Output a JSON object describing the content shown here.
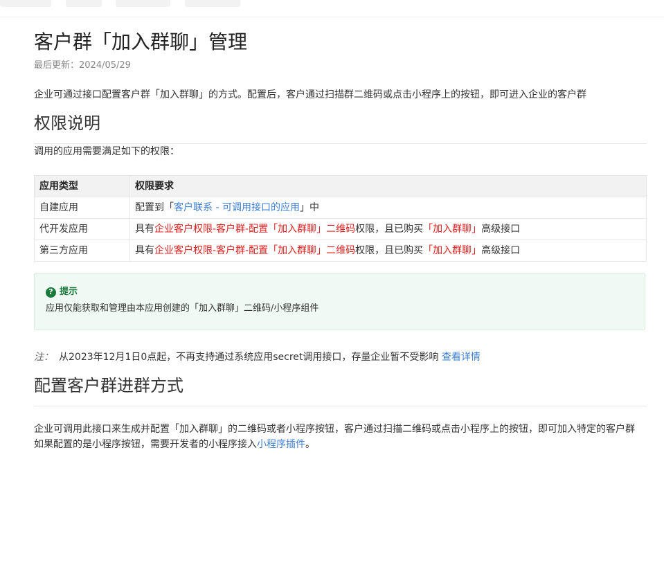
{
  "page": {
    "title": "客户群「加入群聊」管理",
    "last_updated": "最后更新：2024/05/29",
    "intro": "企业可通过接口配置客户群「加入群聊」的方式。配置后，客户通过扫描群二维码或点击小程序上的按钮，即可进入企业的客户群"
  },
  "permissions": {
    "heading": "权限说明",
    "intro": "调用的应用需要满足如下的权限：",
    "table": {
      "headers": [
        "应用类型",
        "权限要求"
      ],
      "rows": [
        {
          "type": "自建应用",
          "req_prefix": "配置到「",
          "req_link": "客户联系 - 可调用接口的应用",
          "req_suffix": "」中"
        },
        {
          "type": "代开发应用",
          "req_prefix": "具有",
          "req_red1": "企业客户权限-客户群-配置「加入群聊」二维码",
          "req_mid": "权限，且已购买",
          "req_red2": "「加入群聊」",
          "req_suffix": "高级接口"
        },
        {
          "type": "第三方应用",
          "req_prefix": "具有",
          "req_red1": "企业客户权限-客户群-配置「加入群聊」二维码",
          "req_mid": "权限，且已购买",
          "req_red2": "「加入群聊」",
          "req_suffix": "高级接口"
        }
      ]
    },
    "tip": {
      "title": "提示",
      "body": "应用仅能获取和管理由本应用创建的「加入群聊」二维码/小程序组件"
    },
    "note": {
      "label": "注：",
      "text": "从2023年12月1日0点起，不再支持通过系统应用secret调用接口，存量企业暂不受影响",
      "link": "查看详情"
    }
  },
  "config": {
    "heading": "配置客户群进群方式",
    "line1": "企业可调用此接口来生成并配置「加入群聊」的二维码或者小程序按钮，客户通过扫描二维码或点击小程序上的按钮，即可加入特定的客户群",
    "line2_prefix": "如果配置的是小程序按钮，需要开发者的小程序接入",
    "line2_link": "小程序插件",
    "line2_suffix": "。"
  },
  "colors": {
    "link": "#3d7fd6",
    "red": "#e02020",
    "tip_green": "#1a7a3c"
  }
}
